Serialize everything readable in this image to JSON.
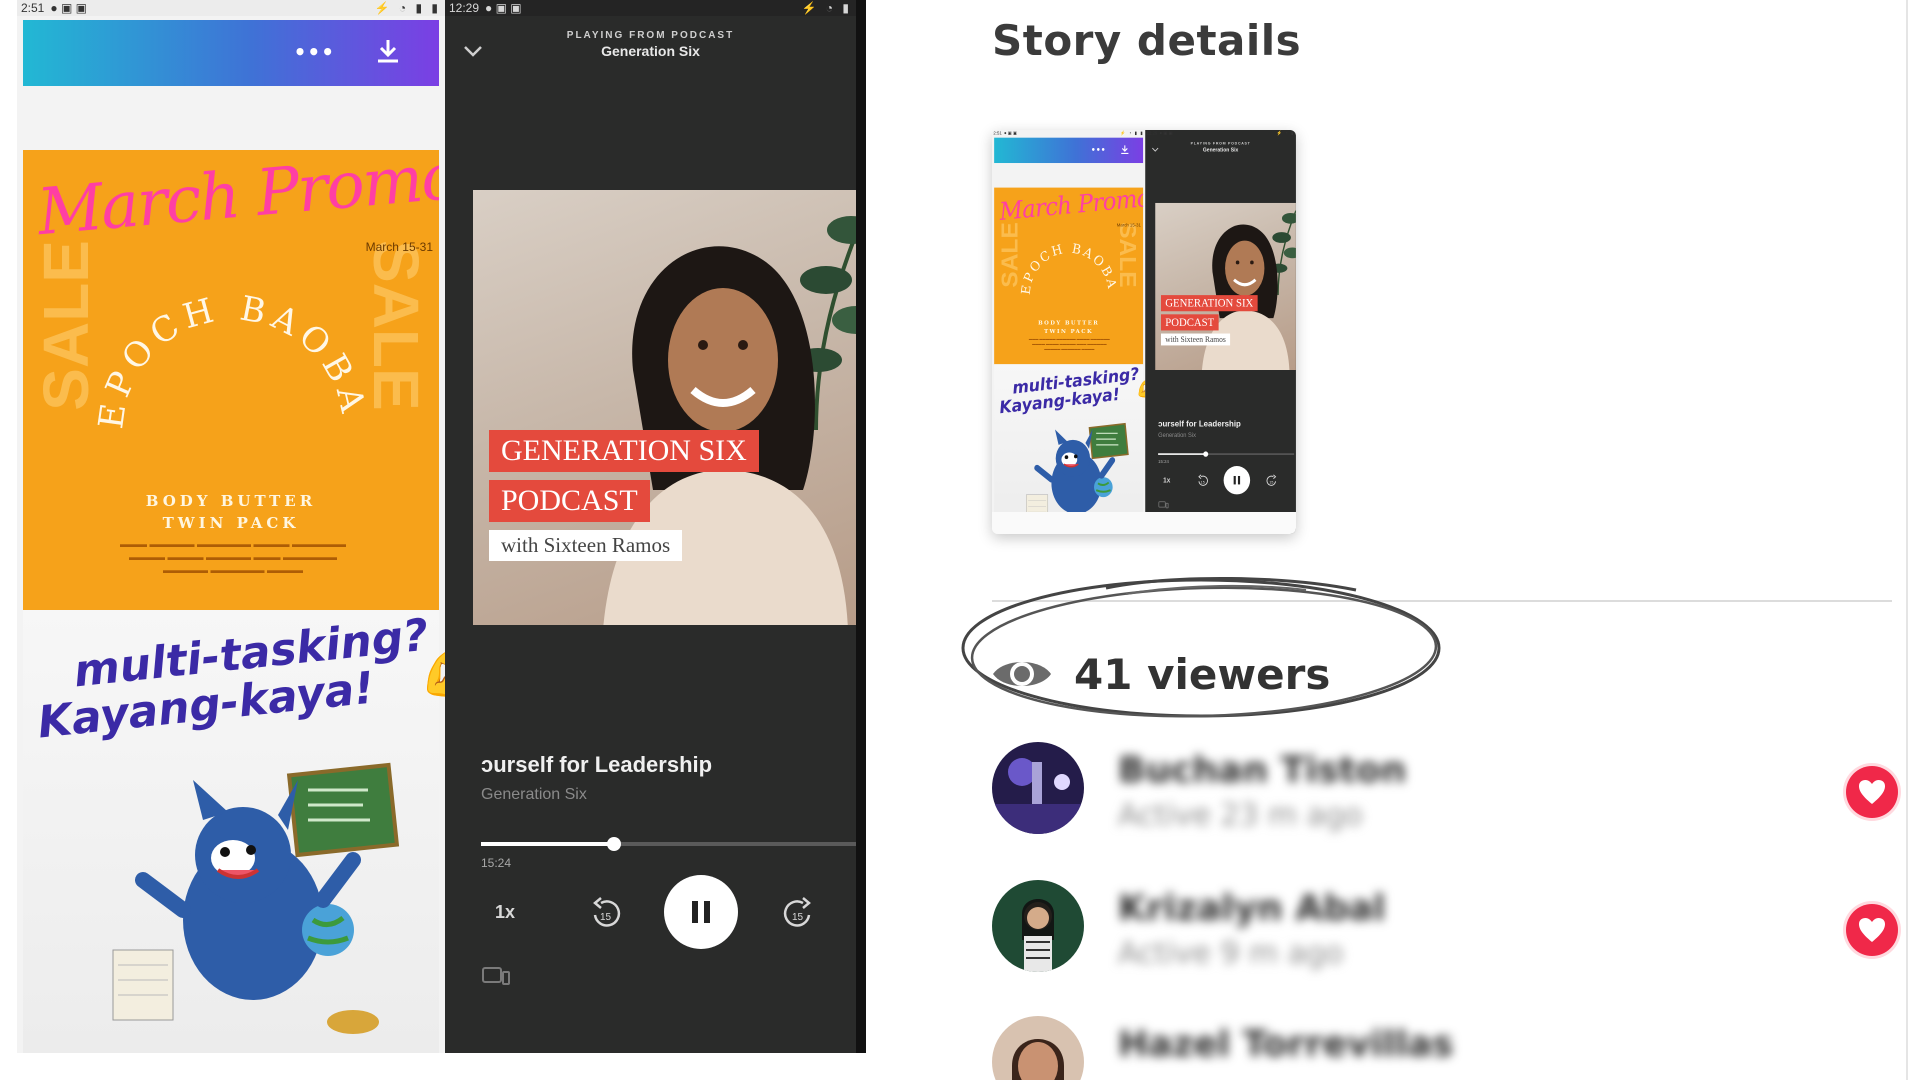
{
  "story": {
    "left_status_time": "2:51",
    "right_status_time": "12:29",
    "promo": {
      "script_title": "March Promo",
      "date": "March 15-31",
      "sale_word": "SALE",
      "arc_text": "EPOCH BAOBAB",
      "product_line1": "BODY BUTTER",
      "product_line2": "TWIN PACK"
    },
    "sticker": {
      "line1": "multi-tasking?",
      "line2": "Kayang-kaya!",
      "emoji": "💪"
    },
    "player": {
      "playing_from": "PLAYING FROM PODCAST",
      "show_name": "Generation Six",
      "cover_line1": "GENERATION SIX",
      "cover_line2": "PODCAST",
      "cover_line3": "with Sixteen Ramos",
      "episode_title": "ɔurself for Leadership",
      "episode_show": "Generation Six",
      "elapsed": "15:24",
      "progress": 0.35,
      "speed": "1x"
    }
  },
  "details": {
    "title": "Story details",
    "viewers_label": "41 viewers",
    "viewers": [
      {
        "name": "Buchan Tiston",
        "active": "Active 23 m ago",
        "reacted": true
      },
      {
        "name": "Krizalyn Abal",
        "active": "Active 9 m ago",
        "reacted": true
      },
      {
        "name": "Hazel Torrevillas",
        "active": "",
        "reacted": false
      }
    ]
  },
  "colors": {
    "heart": "#f02849",
    "promo_orange": "#f6a21a",
    "promo_pink": "#ff3fa4",
    "sticker_purple": "#3b2aa6",
    "cover_red": "#e44a3d",
    "player_bg": "#2a2b2a"
  },
  "icons": [
    "more-dots-icon",
    "download-icon",
    "chevron-down-icon",
    "pause-icon",
    "rewind-15-icon",
    "forward-15-icon",
    "devices-icon",
    "eye-icon",
    "heart-icon"
  ]
}
